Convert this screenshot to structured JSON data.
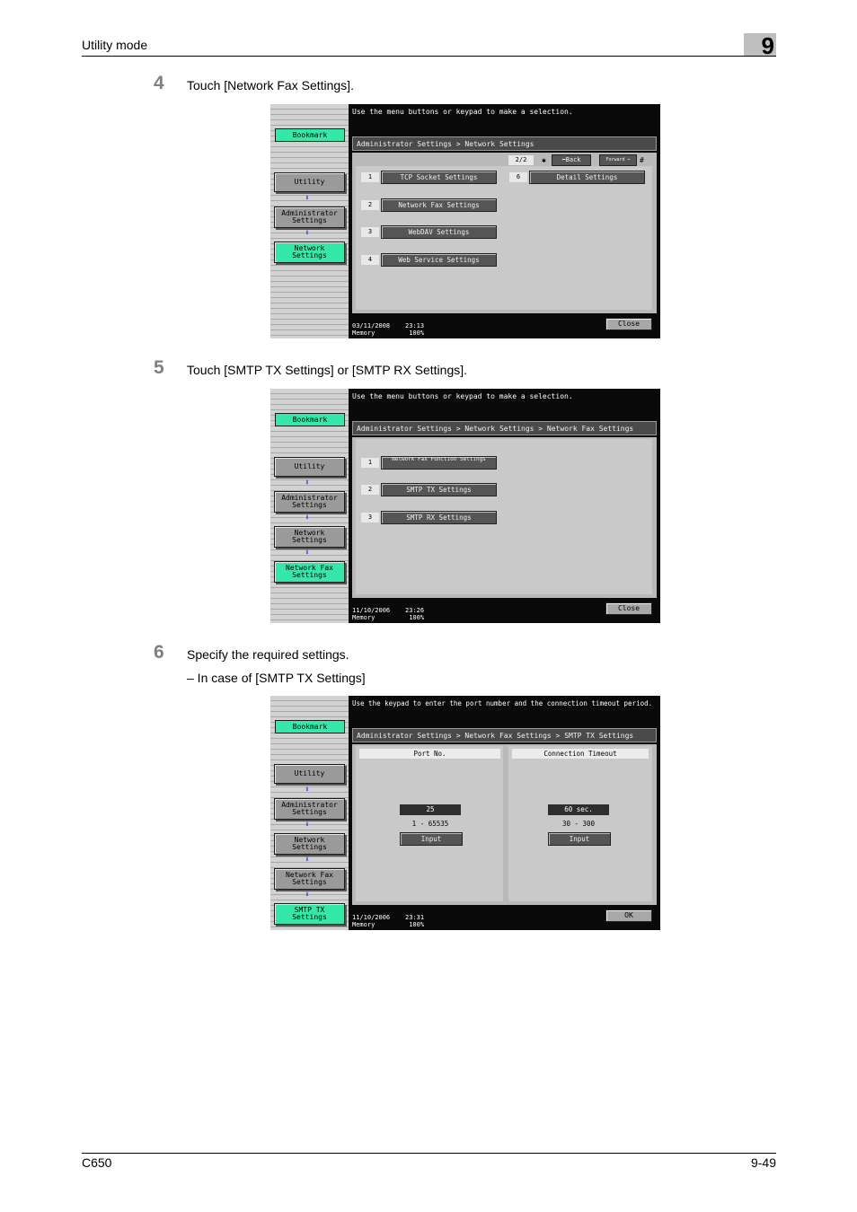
{
  "header": {
    "title": "Utility mode",
    "chapter": "9"
  },
  "footer": {
    "model": "C650",
    "page": "9-49"
  },
  "steps": [
    {
      "number": "4",
      "text": "Touch [Network Fax Settings]."
    },
    {
      "number": "5",
      "text": "Touch [SMTP TX Settings] or [SMTP RX Settings]."
    },
    {
      "number": "6",
      "text": "Specify the required settings.",
      "sub": "–   In case of [SMTP TX Settings]"
    }
  ],
  "screen1": {
    "message": "Use the menu buttons or keypad to make a selection.",
    "bookmark": "Bookmark",
    "nav": [
      "Utility",
      "Administrator\nSettings",
      "Network\nSettings"
    ],
    "arrow": "⬇",
    "breadcrumb": "Administrator Settings > Network Settings",
    "pager": {
      "page": "2/2",
      "star": "✱",
      "back": "⬅Back",
      "forward": "Forward ➡",
      "hash": "#"
    },
    "items": [
      {
        "num": "1",
        "label": "TCP Socket Settings"
      },
      {
        "num": "2",
        "label": "Network Fax Settings"
      },
      {
        "num": "3",
        "label": "WebDAV Settings"
      },
      {
        "num": "4",
        "label": "Web Service Settings"
      },
      {
        "num": "6",
        "label": "Detail Settings"
      }
    ],
    "status": "03/11/2008    23:13\nMemory         100%",
    "close": "Close"
  },
  "screen2": {
    "message": "Use the menu buttons or keypad to make a selection.",
    "bookmark": "Bookmark",
    "nav": [
      "Utility",
      "Administrator\nSettings",
      "Network\nSettings",
      "Network Fax\nSettings"
    ],
    "arrow": "⬇",
    "breadcrumb": "Administrator Settings > Network Settings > Network Fax Settings",
    "items": [
      {
        "num": "1",
        "label": "Network Fax Function Settings"
      },
      {
        "num": "2",
        "label": "SMTP TX Settings"
      },
      {
        "num": "3",
        "label": "SMTP RX Settings"
      }
    ],
    "status": "11/10/2006    23:26\nMemory         100%",
    "close": "Close"
  },
  "screen3": {
    "message": "Use the keypad to enter the port number and the connection timeout period.",
    "bookmark": "Bookmark",
    "nav": [
      "Utility",
      "Administrator\nSettings",
      "Network\nSettings",
      "Network Fax\nSettings",
      "SMTP TX Settings"
    ],
    "arrow": "⬇",
    "breadcrumb": "Administrator Settings > Network Fax Settings > SMTP TX Settings",
    "port": {
      "head": "Port No.",
      "value": "25",
      "range": "1  -  65535",
      "input": "Input"
    },
    "timeout": {
      "head": "Connection Timeout",
      "value": "60 sec.",
      "range": "30  -  300",
      "input": "Input"
    },
    "status": "11/10/2006    23:31\nMemory         100%",
    "ok": "OK"
  }
}
